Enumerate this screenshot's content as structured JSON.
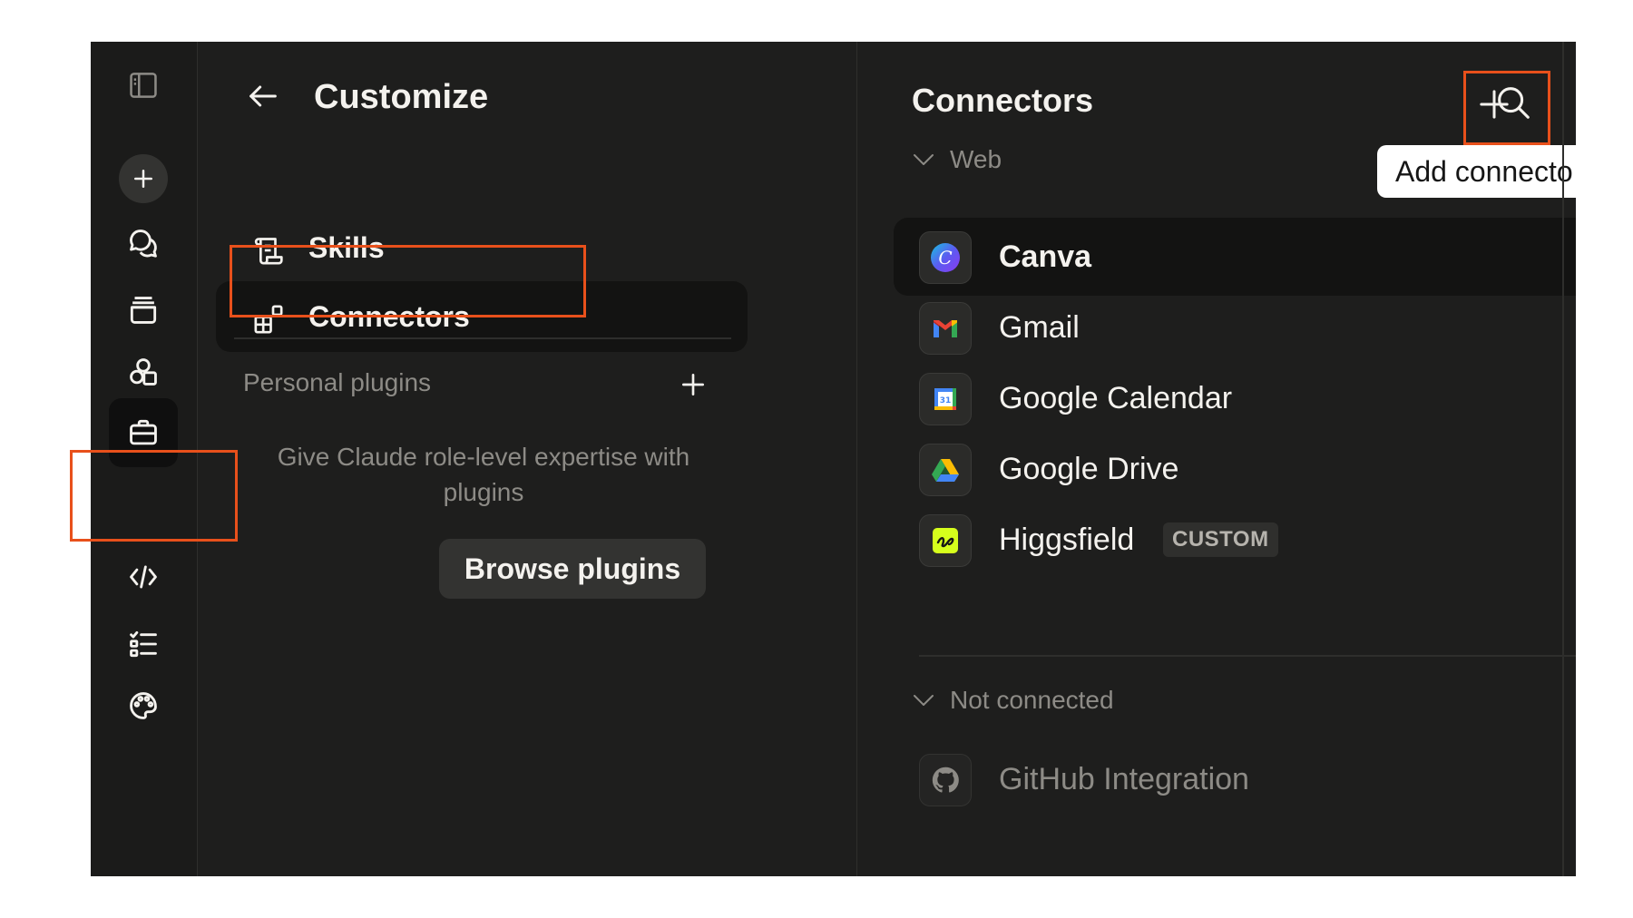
{
  "customize": {
    "title": "Customize",
    "menu": [
      {
        "label": "Skills",
        "icon": "scroll-icon"
      },
      {
        "label": "Connectors",
        "icon": "connectors-icon"
      }
    ],
    "plugins_heading": "Personal plugins",
    "plugins_description": "Give Claude role-level expertise with plugins",
    "browse_button": "Browse plugins"
  },
  "connectors": {
    "title": "Connectors",
    "tooltip": "Add connecto",
    "groups": [
      {
        "label": "Web",
        "items": [
          {
            "name": "Canva",
            "icon": "canva-icon"
          },
          {
            "name": "Gmail",
            "icon": "gmail-icon"
          },
          {
            "name": "Google Calendar",
            "icon": "google-calendar-icon"
          },
          {
            "name": "Google Drive",
            "icon": "google-drive-icon"
          },
          {
            "name": "Higgsfield",
            "icon": "higgsfield-icon",
            "badge": "CUSTOM"
          }
        ]
      },
      {
        "label": "Not connected",
        "items": [
          {
            "name": "GitHub Integration",
            "icon": "github-icon"
          }
        ]
      }
    ]
  },
  "rail": {
    "icons": [
      "sidebar-toggle-icon",
      "plus-icon",
      "chats-icon",
      "projects-icon",
      "artifacts-icon",
      "briefcase-icon",
      "code-icon",
      "checklist-icon",
      "palette-icon"
    ]
  },
  "colors": {
    "background": "#1e1e1d",
    "highlight": "#e8501b",
    "text": "#f4f2ee",
    "muted": "#8d8b86"
  }
}
